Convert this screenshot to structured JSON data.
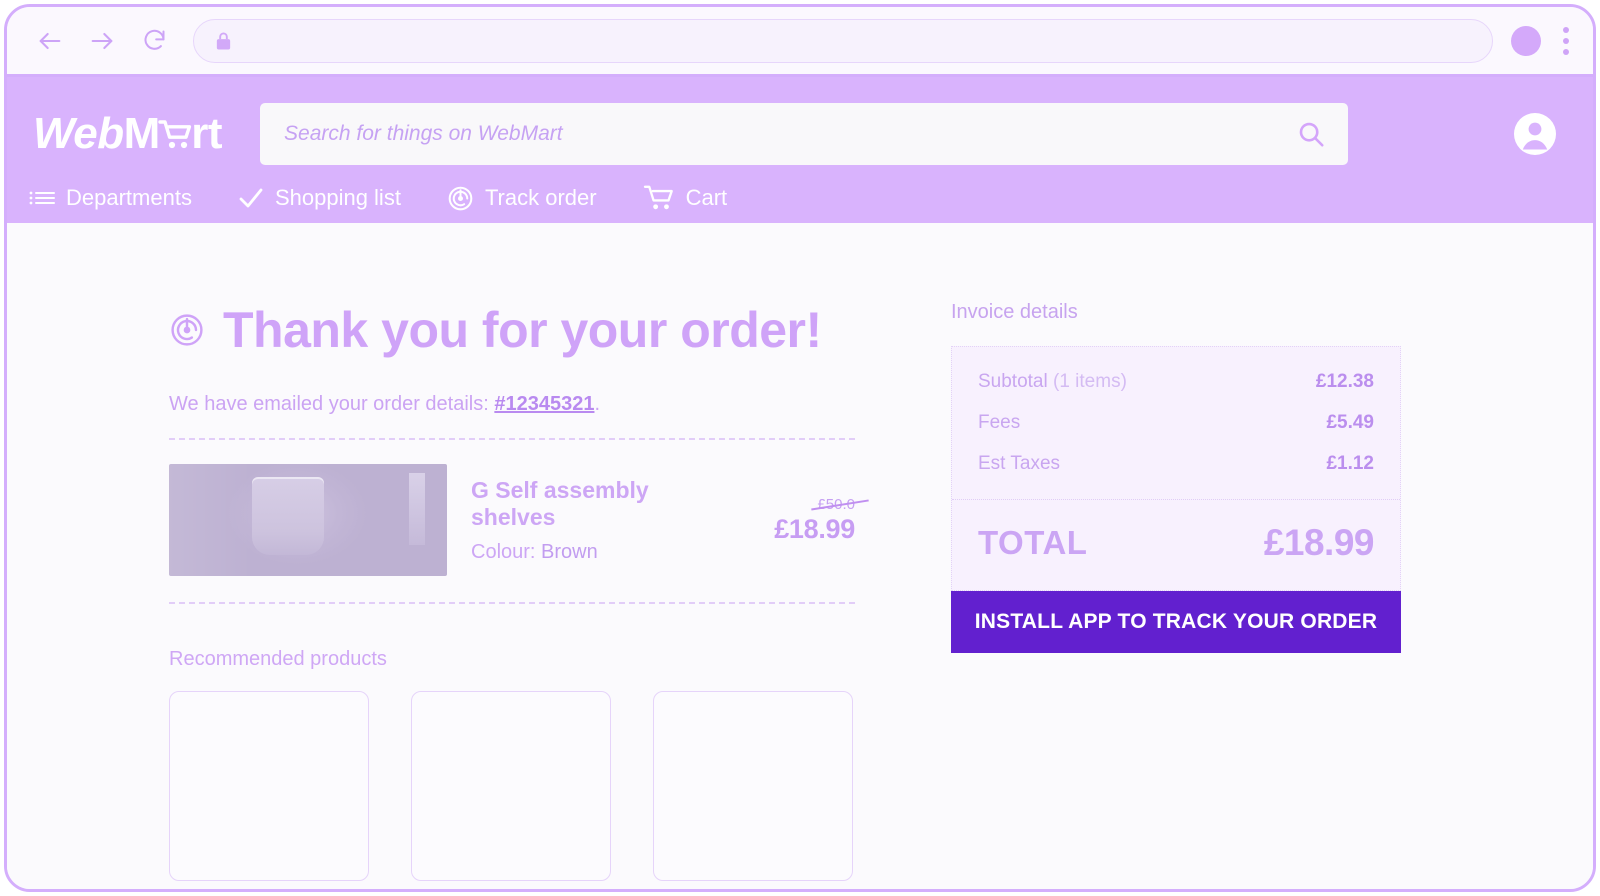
{
  "browser": {
    "back_icon": "back-arrow-icon",
    "forward_icon": "forward-arrow-icon",
    "reload_icon": "reload-icon",
    "lock_icon": "lock-icon",
    "url_value": "",
    "url_placeholder": "",
    "profile_icon": "profile-avatar-icon",
    "menu_icon": "kebab-menu-icon"
  },
  "header": {
    "logo": {
      "part1": "Web",
      "part2": "M",
      "part3": "rt",
      "cart_icon": "shopping-cart-icon"
    },
    "search": {
      "value": "",
      "placeholder": "Search for things on WebMart",
      "icon": "search-icon"
    },
    "account_icon": "account-circle-icon",
    "nav": [
      {
        "label": "Departments",
        "icon": "list-menu-icon"
      },
      {
        "label": "Shopping list",
        "icon": "checkmark-icon"
      },
      {
        "label": "Track order",
        "icon": "target-track-icon"
      },
      {
        "label": "Cart",
        "icon": "shopping-cart-icon"
      }
    ]
  },
  "main": {
    "title": "Thank you for your order!",
    "title_icon": "target-track-icon",
    "emailed_prefix": "We have emailed your order details: ",
    "order_number": "#12345321",
    "emailed_suffix": ".",
    "product": {
      "title": "G Self assembly shelves",
      "colour_label": "Colour:",
      "colour_value": "Brown",
      "price_old": "£50.0",
      "price_new": "£18.99",
      "image_alt": "product-photo"
    },
    "recommended_heading": "Recommended products",
    "recommended_cards": [
      "",
      "",
      ""
    ]
  },
  "invoice": {
    "heading": "Invoice details",
    "rows": [
      {
        "label": "Subtotal",
        "sublabel": " (1 items)",
        "value": "£12.38"
      },
      {
        "label": "Fees",
        "sublabel": "",
        "value": "£5.49"
      },
      {
        "label": "Est Taxes",
        "sublabel": "",
        "value": "£1.12"
      }
    ],
    "total_label": "TOTAL",
    "total_value": "£18.99",
    "install_button": "INSTALL APP TO TRACK YOUR ORDER"
  },
  "colors": {
    "header_purple": "#d9b3fd",
    "accent_light": "#cfa3f8",
    "cta_purple": "#6220cf",
    "page_bg": "#fbfafd"
  }
}
